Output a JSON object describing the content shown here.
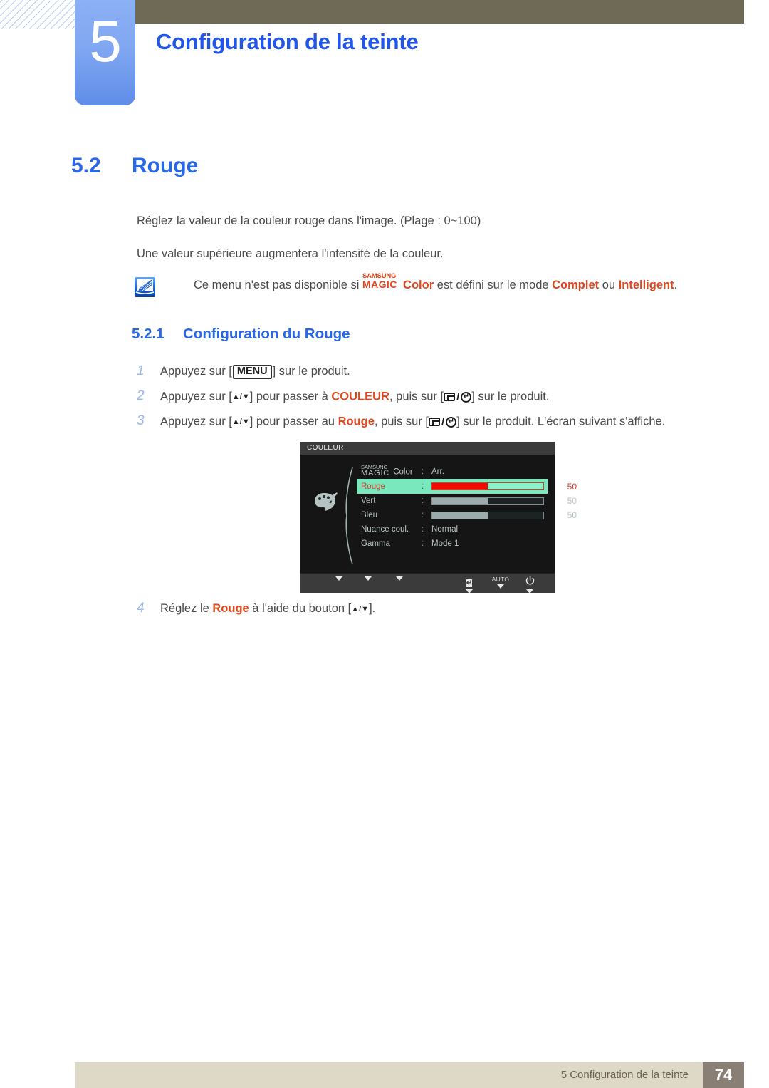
{
  "header": {
    "chapter_number": "5",
    "chapter_title": "Configuration de la teinte",
    "accent_blue": "#2256e8",
    "bar_color": "#6e6a55"
  },
  "section": {
    "number": "5.2",
    "title": "Rouge",
    "paragraph_1": "Réglez la valeur de la couleur rouge dans l'image. (Plage : 0~100)",
    "paragraph_2": "Une valeur supérieure augmentera l'intensité de la couleur."
  },
  "note": {
    "icon": "note-pencil-icon",
    "text_before": "Ce menu n'est pas disponible si ",
    "magic_line1": "SAMSUNG",
    "magic_line2": "MAGIC",
    "magic_suffix": "Color",
    "text_middle": " est défini sur le mode ",
    "mode_1": "Complet",
    "text_or": " ou ",
    "mode_2": "Intelligent",
    "text_end": ".",
    "accent_color": "#e0471e"
  },
  "subsection": {
    "number": "5.2.1",
    "title": "Configuration du Rouge"
  },
  "steps": [
    {
      "n": "1",
      "pre": "Appuyez sur [",
      "key": "MENU",
      "post": "] sur le produit."
    },
    {
      "n": "2",
      "pre": "Appuyez sur [",
      "arrows": "▲/▼",
      "mid": "] pour passer à ",
      "accent": "COULEUR",
      "mid2": ", puis sur [",
      "post": "] sur le produit."
    },
    {
      "n": "3",
      "pre": "Appuyez sur [",
      "arrows": "▲/▼",
      "mid": "] pour passer au ",
      "accent": "Rouge",
      "mid2": ", puis sur [",
      "post": "] sur le produit. L'écran suivant s'affiche."
    },
    {
      "n": "4",
      "pre": "Réglez le ",
      "accent": "Rouge",
      "mid": " à l'aide du bouton [",
      "arrows": "▲/▼",
      "post": "]."
    }
  ],
  "osd": {
    "title": "COULEUR",
    "left_icon": "color-palette-icon",
    "rows": [
      {
        "label_kind": "magic",
        "magic_l1": "SAMSUNG",
        "magic_l2": "MAGIC",
        "magic_suffix": " Color",
        "colon": ":",
        "value_kind": "text",
        "value": "Arr.",
        "selected": false
      },
      {
        "label_kind": "text",
        "label": "Rouge",
        "colon": ":",
        "value_kind": "bar",
        "value": "50",
        "fill_pct": 50,
        "selected": true
      },
      {
        "label_kind": "text",
        "label": "Vert",
        "colon": ":",
        "value_kind": "bar",
        "value": "50",
        "fill_pct": 50,
        "selected": false
      },
      {
        "label_kind": "text",
        "label": "Bleu",
        "colon": ":",
        "value_kind": "bar",
        "value": "50",
        "fill_pct": 50,
        "selected": false
      },
      {
        "label_kind": "text",
        "label": "Nuance coul.",
        "colon": ":",
        "value_kind": "text",
        "value": "Normal",
        "selected": false
      },
      {
        "label_kind": "text",
        "label": "Gamma",
        "colon": ":",
        "value_kind": "text",
        "value": "Mode 1",
        "selected": false
      }
    ],
    "footer_buttons": [
      {
        "name": "back-button",
        "icon": "left-arrow-icon",
        "caption": ""
      },
      {
        "name": "minus-button",
        "icon": "minus-icon",
        "caption": ""
      },
      {
        "name": "plus-button",
        "icon": "plus-icon",
        "caption": ""
      },
      {
        "name": "enter-button",
        "icon": "enter-icon",
        "caption": ""
      },
      {
        "name": "auto-button",
        "icon": "",
        "caption": "AUTO"
      },
      {
        "name": "power-button",
        "icon": "power-icon",
        "caption": ""
      }
    ],
    "selected_row_bg": "#79e8bc",
    "selected_accent": "#d93a2a",
    "bar_fill_color": "#9aacac",
    "bar_fill_selected_color": "#f20a00"
  },
  "footer": {
    "text": "5 Configuration de la teinte",
    "page_number": "74",
    "bar_color": "#ded8c6",
    "page_box_color": "#8a7f74"
  }
}
